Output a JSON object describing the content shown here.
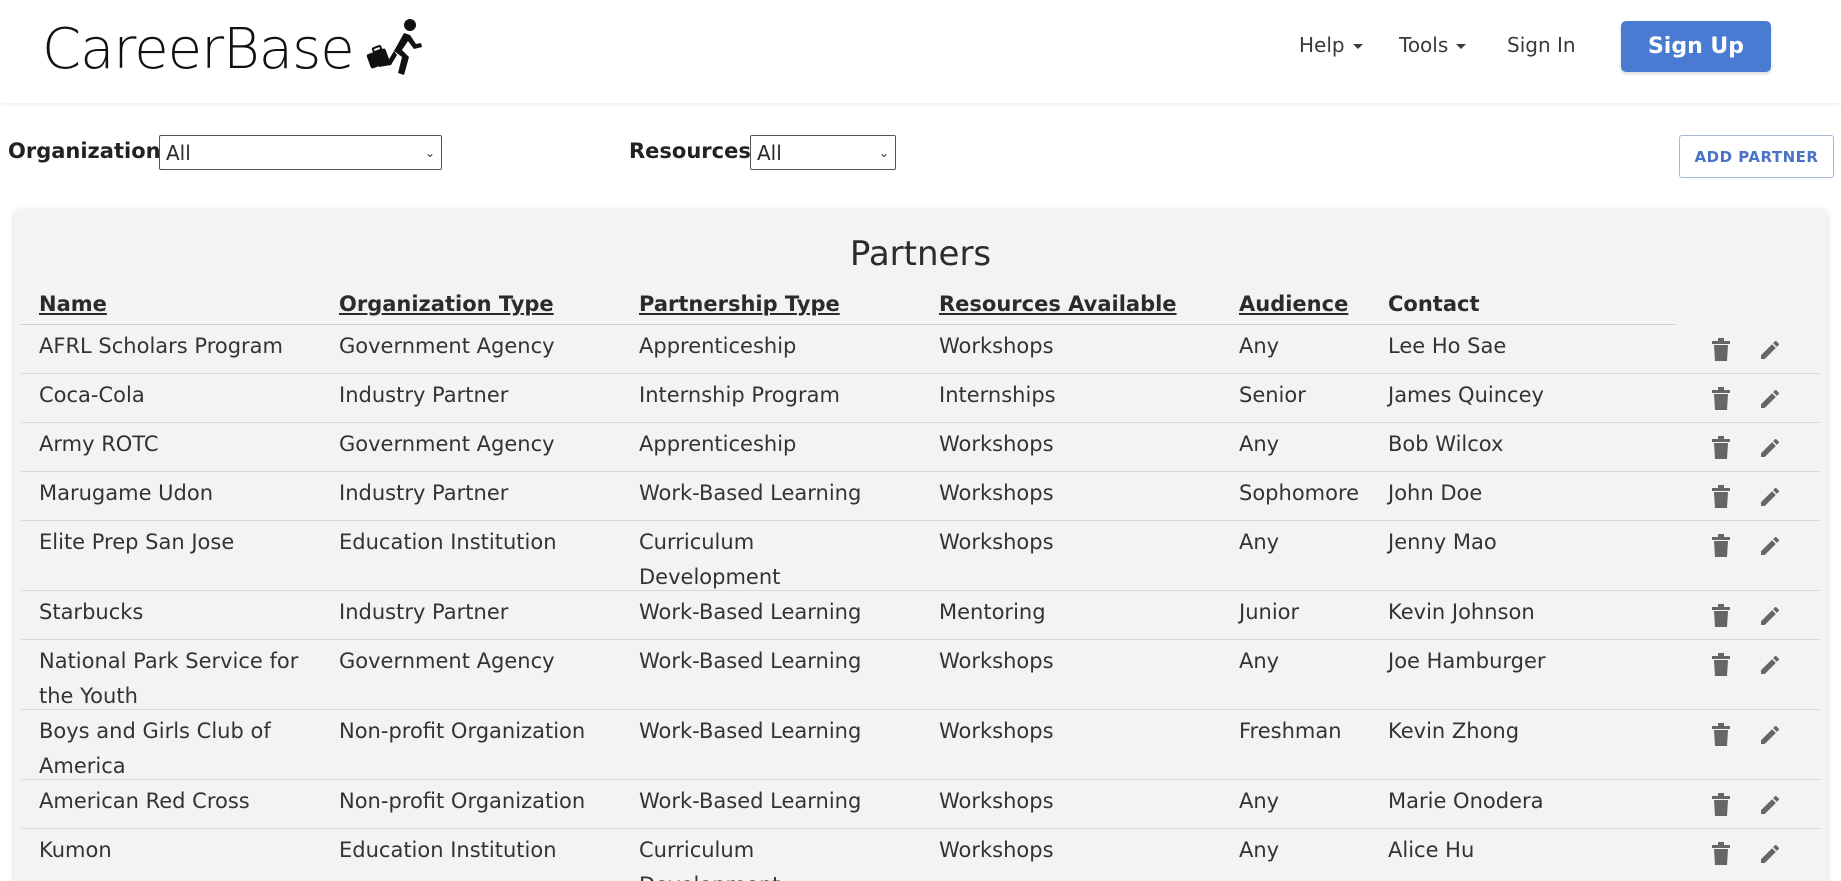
{
  "brand": {
    "name": "CareerBase"
  },
  "nav": {
    "help_label": "Help",
    "tools_label": "Tools",
    "signin_label": "Sign In",
    "signup_label": "Sign Up"
  },
  "filters": {
    "organization_label": "Organization",
    "organization_value": "All",
    "resources_label": "Resources",
    "resources_value": "All"
  },
  "add_partner_label": "ADD PARTNER",
  "table": {
    "title": "Partners",
    "columns": [
      "Name",
      "Organization Type",
      "Partnership Type",
      "Resources Available",
      "Audience",
      "Contact"
    ],
    "rows": [
      [
        "AFRL Scholars Program",
        "Government Agency",
        "Apprenticeship",
        "Workshops",
        "Any",
        "Lee Ho Sae"
      ],
      [
        "Coca-Cola",
        "Industry Partner",
        "Internship Program",
        "Internships",
        "Senior",
        "James Quincey"
      ],
      [
        "Army ROTC",
        "Government Agency",
        "Apprenticeship",
        "Workshops",
        "Any",
        "Bob Wilcox"
      ],
      [
        "Marugame Udon",
        "Industry Partner",
        "Work-Based Learning",
        "Workshops",
        "Sophomore",
        "John Doe"
      ],
      [
        "Elite Prep San Jose",
        "Education Institution",
        "Curriculum Development",
        "Workshops",
        "Any",
        "Jenny Mao"
      ],
      [
        "Starbucks",
        "Industry Partner",
        "Work-Based Learning",
        "Mentoring",
        "Junior",
        "Kevin Johnson"
      ],
      [
        "National Park Service for the Youth",
        "Government Agency",
        "Work-Based Learning",
        "Workshops",
        "Any",
        "Joe Hamburger"
      ],
      [
        "Boys and Girls Club of America",
        "Non-profit Organization",
        "Work-Based Learning",
        "Workshops",
        "Freshman",
        "Kevin Zhong"
      ],
      [
        "American Red Cross",
        "Non-profit Organization",
        "Work-Based Learning",
        "Workshops",
        "Any",
        "Marie Onodera"
      ],
      [
        "Kumon",
        "Education Institution",
        "Curriculum Development",
        "Workshops",
        "Any",
        "Alice Hu"
      ]
    ]
  },
  "colors": {
    "accent": "#4a7bd3",
    "panel_bg": "#f3f3f3",
    "icon": "#666666"
  }
}
